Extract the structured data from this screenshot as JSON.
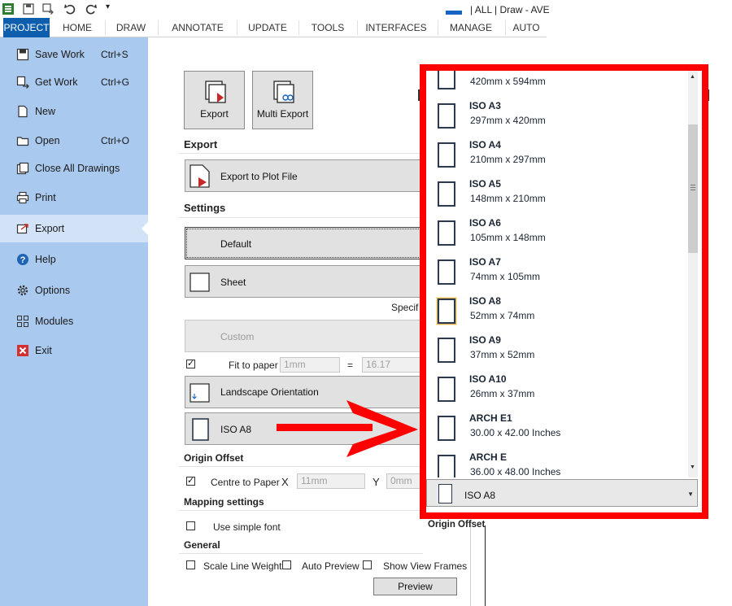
{
  "title_bar": {
    "text": "| ALL | Draw - AVE"
  },
  "quick_access": {
    "overflow": "▾"
  },
  "ribbon": {
    "tabs": [
      "PROJECT",
      "HOME",
      "DRAW",
      "ANNOTATE",
      "UPDATE",
      "TOOLS",
      "INTERFACES",
      "MANAGE",
      "AUTO"
    ],
    "active_tab": "PROJECT"
  },
  "sidebar": {
    "items": [
      {
        "label": "Save Work",
        "shortcut": "Ctrl+S",
        "icon": "save-icon"
      },
      {
        "label": "Get Work",
        "shortcut": "Ctrl+G",
        "icon": "get-work-icon"
      },
      {
        "label": "New",
        "shortcut": "",
        "icon": "new-file-icon"
      },
      {
        "label": "Open",
        "shortcut": "Ctrl+O",
        "icon": "open-folder-icon"
      },
      {
        "label": "Close All Drawings",
        "shortcut": "",
        "icon": "close-drawings-icon"
      },
      {
        "label": "Print",
        "shortcut": "",
        "icon": "print-icon"
      },
      {
        "label": "Export",
        "shortcut": "",
        "icon": "export-icon"
      },
      {
        "label": "Help",
        "shortcut": "",
        "icon": "help-icon"
      },
      {
        "label": "Options",
        "shortcut": "",
        "icon": "gear-icon"
      },
      {
        "label": "Modules",
        "shortcut": "",
        "icon": "modules-icon"
      },
      {
        "label": "Exit",
        "shortcut": "",
        "icon": "exit-icon"
      }
    ],
    "active_item": "Export"
  },
  "main": {
    "export_button": "Export",
    "multi_export_button": "Multi Export",
    "export_section": "Export",
    "export_to_plot": "Export to Plot File",
    "settings_section": "Settings",
    "default_option": "Default",
    "sheet_option": "Sheet",
    "specif_text": "Specif",
    "custom_option": "Custom",
    "fit_to_paper": {
      "label": "Fit to paper",
      "checked": true,
      "value": "1mm",
      "equals": "=",
      "ratio": "16.17"
    },
    "landscape_orientation": "Landscape Orientation",
    "paper_selected": "ISO A8",
    "origin_offset_section": "Origin Offset",
    "centre_to_paper": {
      "label": "Centre to Paper",
      "checked": true,
      "x_label": "X",
      "x_value": "11mm",
      "y_label": "Y",
      "y_value": "0mm"
    },
    "mapping_section": "Mapping settings",
    "use_simple_font": {
      "label": "Use simple font",
      "checked": false
    },
    "general_section": "General",
    "scale_line_weight": {
      "label": "Scale Line Weight",
      "checked": false
    },
    "auto_preview": {
      "label": "Auto Preview",
      "checked": false
    },
    "show_view_frames": {
      "label": "Show View Frames",
      "checked": false
    },
    "preview_button": "Preview"
  },
  "paper_popup": {
    "items": [
      {
        "name": "",
        "dims": "420mm x 594mm"
      },
      {
        "name": "ISO A3",
        "dims": "297mm x 420mm"
      },
      {
        "name": "ISO A4",
        "dims": "210mm x 297mm"
      },
      {
        "name": "ISO A5",
        "dims": "148mm x 210mm"
      },
      {
        "name": "ISO A6",
        "dims": "105mm x 148mm"
      },
      {
        "name": "ISO A7",
        "dims": "74mm x 105mm"
      },
      {
        "name": "ISO A8",
        "dims": "52mm x 74mm"
      },
      {
        "name": "ISO A9",
        "dims": "37mm x 52mm"
      },
      {
        "name": "ISO A10",
        "dims": "26mm x 37mm"
      },
      {
        "name": "ARCH E1",
        "dims": "30.00 x 42.00 Inches"
      },
      {
        "name": "ARCH E",
        "dims": "36.00 x 48.00 Inches"
      }
    ],
    "highlighted": "ISO A8",
    "dropdown_value": "ISO A8",
    "below_label": "Origin Offset"
  },
  "colors": {
    "sidebar_bg": "#a9c9ee",
    "active_tab": "#0d5fad",
    "annotation": "#ff0000"
  }
}
